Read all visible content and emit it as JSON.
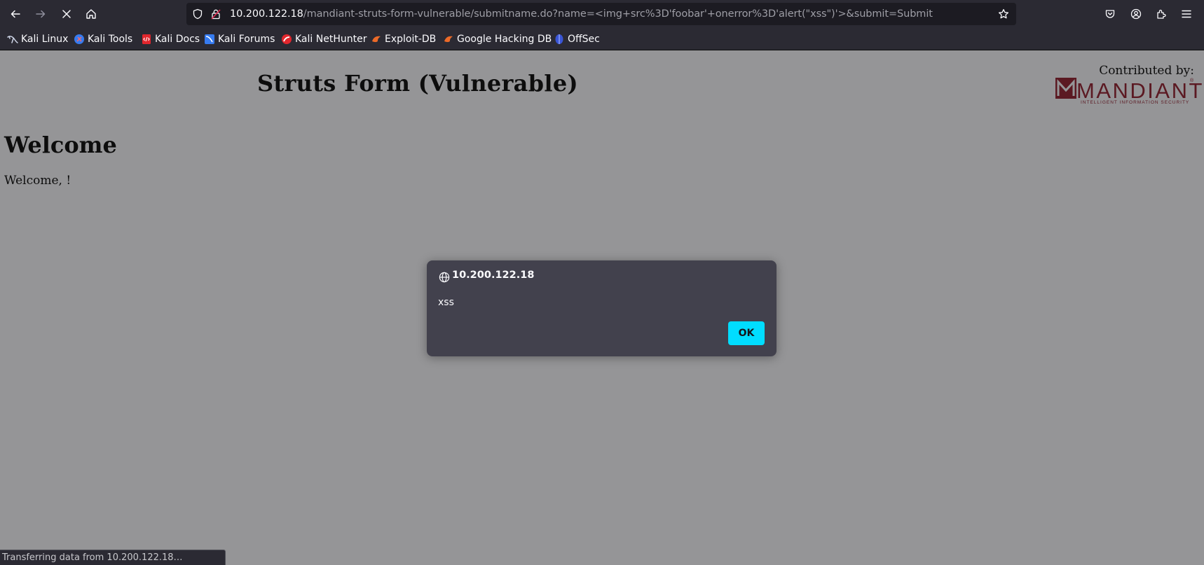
{
  "browser": {
    "url": {
      "host": "10.200.122.18",
      "path": "/mandiant-struts-form-vulnerable/submitname.do?name=<img+src%3D'foobar'+onerror%3D'alert(\"xss\")'>&submit=Submit"
    },
    "toolbar_icons": {
      "back": "back-arrow-icon",
      "forward": "forward-arrow-icon",
      "stop": "stop-loading-icon",
      "home": "home-icon",
      "shield": "tracking-protection-shield-icon",
      "lock": "insecure-lock-icon",
      "bookmark_star": "bookmark-star-icon",
      "pocket": "pocket-icon",
      "account": "account-icon",
      "extensions": "extensions-icon",
      "menu": "hamburger-menu-icon"
    },
    "bookmarks": [
      {
        "label": "Kali Linux",
        "icon": "kali-dragon-icon"
      },
      {
        "label": "Kali Tools",
        "icon": "kali-tools-icon"
      },
      {
        "label": "Kali Docs",
        "icon": "kali-docs-icon"
      },
      {
        "label": "Kali Forums",
        "icon": "kali-forums-icon"
      },
      {
        "label": "Kali NetHunter",
        "icon": "nethunter-icon"
      },
      {
        "label": "Exploit-DB",
        "icon": "exploit-db-icon"
      },
      {
        "label": "Google Hacking DB",
        "icon": "ghdb-icon"
      },
      {
        "label": "OffSec",
        "icon": "offsec-icon"
      }
    ],
    "status_text": "Transferring data from 10.200.122.18…"
  },
  "page": {
    "title": "Struts Form (Vulnerable)",
    "contributed_by": "Contributed by:",
    "logo": {
      "word": "MANDIANT",
      "tagline": "INTELLIGENT INFORMATION SECURITY",
      "color": "#5b1922"
    },
    "heading": "Welcome",
    "message": "Welcome, !"
  },
  "alert_dialog": {
    "origin": "10.200.122.18",
    "message": "xss",
    "ok_label": "OK",
    "button_color": "#00ddff"
  }
}
